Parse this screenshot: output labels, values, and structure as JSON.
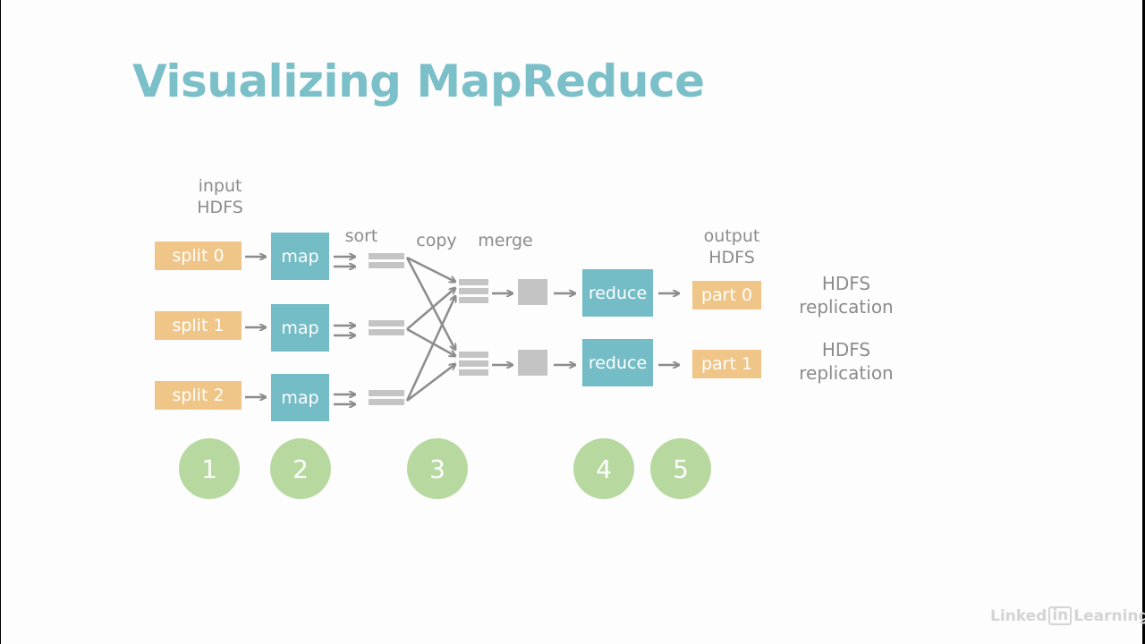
{
  "slide": {
    "title": "Visualizing MapReduce",
    "colors": {
      "title": "#7bbfc9",
      "split": "#efc588",
      "task": "#74bcc6",
      "step_circle": "#b7d99f",
      "connector": "#8c8c8c",
      "intermediate": "#c4c4c4"
    }
  },
  "diagram": {
    "labels": {
      "input": [
        "input",
        "HDFS"
      ],
      "sort": "sort",
      "copy": "copy",
      "merge": "merge",
      "output": [
        "output",
        "HDFS"
      ]
    },
    "splits": [
      "split 0",
      "split 1",
      "split 2"
    ],
    "mappers": [
      "map",
      "map",
      "map"
    ],
    "reducers": [
      "reduce",
      "reduce"
    ],
    "parts": [
      "part 0",
      "part 1"
    ],
    "replication": [
      [
        "HDFS",
        "replication"
      ],
      [
        "HDFS",
        "replication"
      ]
    ],
    "steps": [
      "1",
      "2",
      "3",
      "4",
      "5"
    ]
  },
  "branding": {
    "logo_linked": "Linked",
    "logo_in": "in",
    "logo_learning": "Learning"
  }
}
